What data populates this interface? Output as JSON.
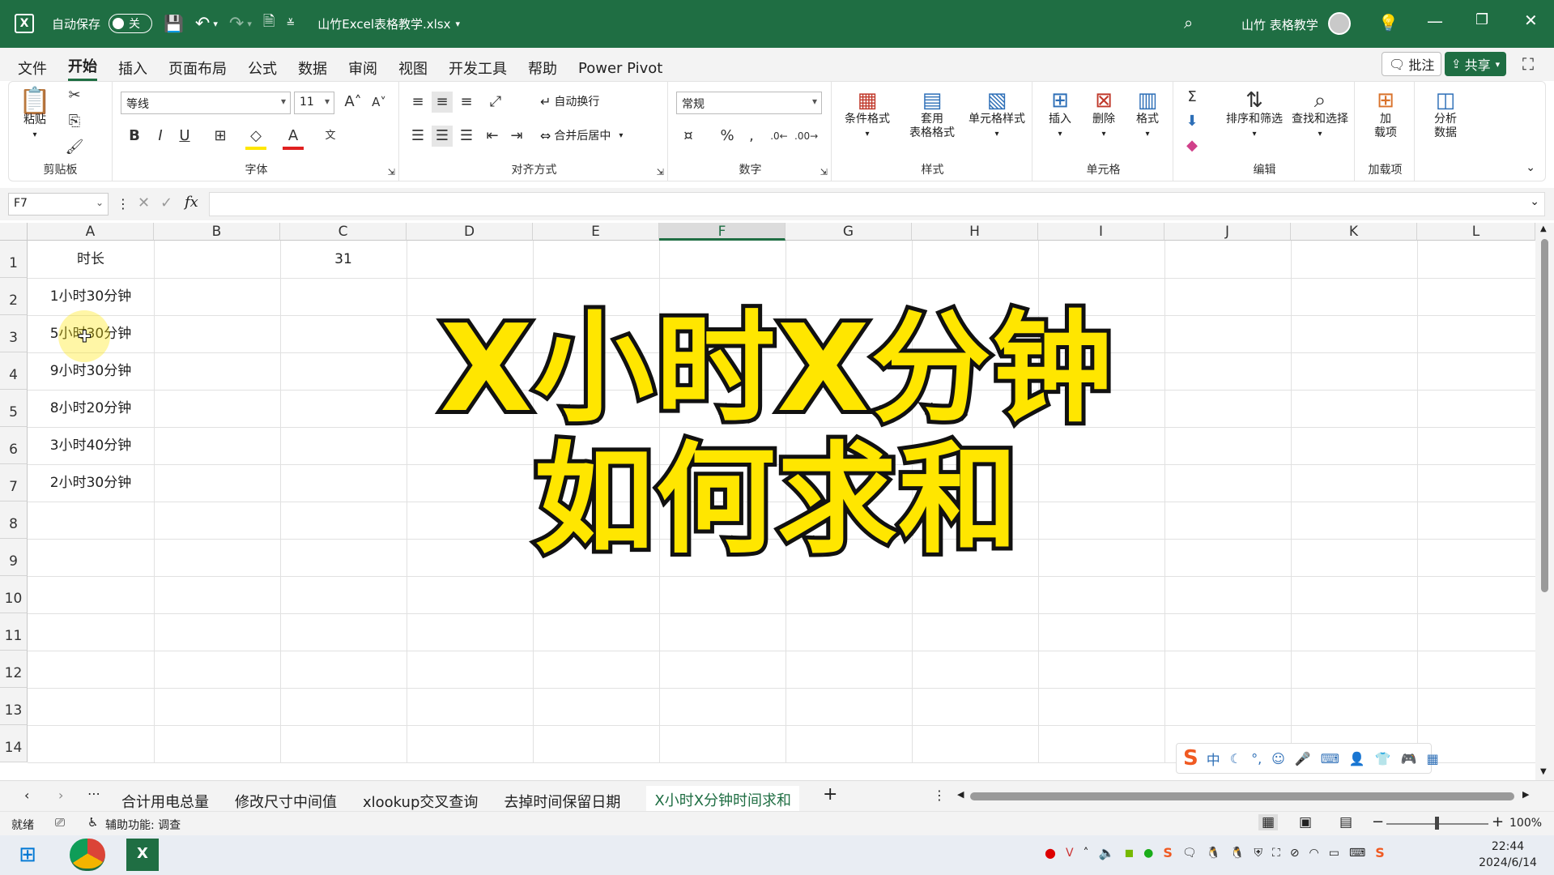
{
  "titlebar": {
    "autosave_label": "自动保存",
    "autosave_state": "关",
    "file_name": "山竹Excel表格教学.xlsx",
    "user_name": "山竹 表格教学"
  },
  "menu": {
    "items": [
      "文件",
      "开始",
      "插入",
      "页面布局",
      "公式",
      "数据",
      "审阅",
      "视图",
      "开发工具",
      "帮助",
      "Power Pivot"
    ],
    "comments_label": "批注",
    "share_label": "共享"
  },
  "ribbon": {
    "clipboard": {
      "paste": "粘贴",
      "group": "剪贴板"
    },
    "font": {
      "name": "等线",
      "size": "11",
      "group": "字体"
    },
    "alignment": {
      "wrap": "自动换行",
      "merge": "合并后居中",
      "group": "对齐方式"
    },
    "number": {
      "format": "常规",
      "group": "数字"
    },
    "styles": {
      "conditional": "条件格式",
      "table_1": "套用",
      "table_2": "表格格式",
      "cell_styles": "单元格样式",
      "group": "样式"
    },
    "cells": {
      "insert": "插入",
      "delete": "删除",
      "format": "格式",
      "group": "单元格"
    },
    "editing": {
      "sort": "排序和筛选",
      "find": "查找和选择",
      "group": "编辑"
    },
    "addins": {
      "line1": "加",
      "line2": "载项",
      "group": "加载项"
    },
    "analyze": {
      "line1": "分析",
      "line2": "数据"
    }
  },
  "formula_bar": {
    "name_box": "F7",
    "formula": "",
    "fx": "fx"
  },
  "columns": [
    "A",
    "B",
    "C",
    "D",
    "E",
    "F",
    "G",
    "H",
    "I",
    "J",
    "K",
    "L"
  ],
  "selected_column": "F",
  "rows": [
    "1",
    "2",
    "3",
    "4",
    "5",
    "6",
    "7",
    "8",
    "9",
    "10",
    "11",
    "12",
    "13",
    "14"
  ],
  "cells": {
    "A1": "时长",
    "C1": "31",
    "A2": "1小时30分钟",
    "A3": "5小时30分钟",
    "A4": "9小时30分钟",
    "A5": "8小时20分钟",
    "A6": "3小时40分钟",
    "A7": "2小时30分钟"
  },
  "overlay": {
    "line1": "X小时X分钟",
    "line2": "如何求和"
  },
  "sheets": {
    "tabs": [
      "合计用电总量",
      "修改尺寸中间值",
      "xlookup交叉查询",
      "去掉时间保留日期",
      "X小时X分钟时间求和"
    ],
    "active_index": 4
  },
  "status": {
    "ready": "就绪",
    "accessibility": "辅助功能: 调查",
    "zoom": "100%"
  },
  "taskbar": {
    "time": "22:44",
    "date": "2024/6/14"
  },
  "ime": {
    "mode": "中"
  },
  "colors": {
    "brand": "#1f6e43",
    "overlay_fill": "#ffe600",
    "overlay_stroke": "#111111"
  }
}
